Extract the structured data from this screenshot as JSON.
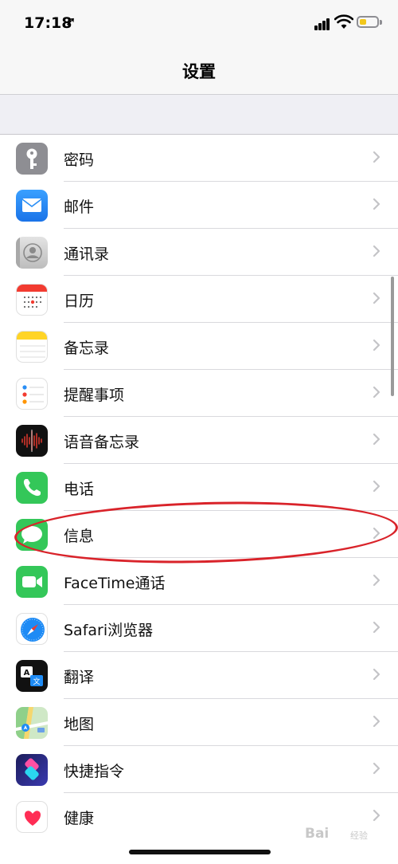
{
  "status": {
    "time": "17:18",
    "location_arrow": "➚"
  },
  "nav": {
    "title": "设置"
  },
  "rows": [
    {
      "label": "密码",
      "icon": "key-icon",
      "color": "#8e8e93"
    },
    {
      "label": "邮件",
      "icon": "mail-icon",
      "color": "#2a8ef5"
    },
    {
      "label": "通讯录",
      "icon": "contacts-icon",
      "color": "#c9c9c9"
    },
    {
      "label": "日历",
      "icon": "calendar-icon",
      "color": "#ffffff"
    },
    {
      "label": "备忘录",
      "icon": "notes-icon",
      "color": "#ffd426"
    },
    {
      "label": "提醒事项",
      "icon": "reminders-icon",
      "color": "#ffffff"
    },
    {
      "label": "语音备忘录",
      "icon": "voice-memos-icon",
      "color": "#111111"
    },
    {
      "label": "电话",
      "icon": "phone-icon",
      "color": "#34c759"
    },
    {
      "label": "信息",
      "icon": "messages-icon",
      "color": "#34c759"
    },
    {
      "label": "FaceTime通话",
      "icon": "facetime-icon",
      "color": "#34c759"
    },
    {
      "label": "Safari浏览器",
      "icon": "safari-icon",
      "color": "#ffffff"
    },
    {
      "label": "翻译",
      "icon": "translate-icon",
      "color": "#111111"
    },
    {
      "label": "地图",
      "icon": "maps-icon",
      "color": "#7ec87a"
    },
    {
      "label": "快捷指令",
      "icon": "shortcuts-icon",
      "color": "#2b2b8f"
    },
    {
      "label": "健康",
      "icon": "health-icon",
      "color": "#ffffff"
    }
  ],
  "watermark": {
    "text": "Bai",
    "sub": "经验"
  }
}
